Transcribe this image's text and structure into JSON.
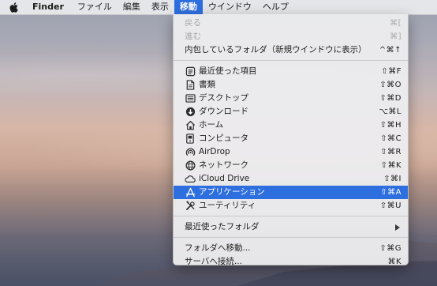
{
  "menubar": {
    "app_name": "Finder",
    "items": [
      "ファイル",
      "編集",
      "表示",
      "移動",
      "ウインドウ",
      "ヘルプ"
    ],
    "active_item": "移動"
  },
  "go_menu": {
    "back": {
      "label": "戻る",
      "shortcut": "⌘["
    },
    "forward": {
      "label": "進む",
      "shortcut": "⌘]"
    },
    "enclosing": {
      "label": "内包しているフォルダ（新規ウインドウに表示）",
      "shortcut": "^⌘↑"
    },
    "places": [
      {
        "label": "最近使った項目",
        "shortcut": "⇧⌘F",
        "icon": "recents-icon"
      },
      {
        "label": "書類",
        "shortcut": "⇧⌘O",
        "icon": "documents-icon"
      },
      {
        "label": "デスクトップ",
        "shortcut": "⇧⌘D",
        "icon": "desktop-icon"
      },
      {
        "label": "ダウンロード",
        "shortcut": "⌥⌘L",
        "icon": "downloads-icon"
      },
      {
        "label": "ホーム",
        "shortcut": "⇧⌘H",
        "icon": "home-icon"
      },
      {
        "label": "コンピュータ",
        "shortcut": "⇧⌘C",
        "icon": "computer-icon"
      },
      {
        "label": "AirDrop",
        "shortcut": "⇧⌘R",
        "icon": "airdrop-icon"
      },
      {
        "label": "ネットワーク",
        "shortcut": "⇧⌘K",
        "icon": "network-icon"
      },
      {
        "label": "iCloud Drive",
        "shortcut": "⇧⌘I",
        "icon": "icloud-icon"
      },
      {
        "label": "アプリケーション",
        "shortcut": "⇧⌘A",
        "icon": "applications-icon"
      },
      {
        "label": "ユーティリティ",
        "shortcut": "⇧⌘U",
        "icon": "utilities-icon"
      }
    ],
    "highlighted_item": "アプリケーション",
    "recent_folders": {
      "label": "最近使ったフォルダ"
    },
    "go_to_folder": {
      "label": "フォルダへ移動...",
      "shortcut": "⇧⌘G"
    },
    "connect_server": {
      "label": "サーバへ接続...",
      "shortcut": "⌘K"
    }
  },
  "colors": {
    "highlight": "#2e6fe0",
    "menu_bg": "#ececee",
    "disabled_text": "#a9a9ad"
  }
}
